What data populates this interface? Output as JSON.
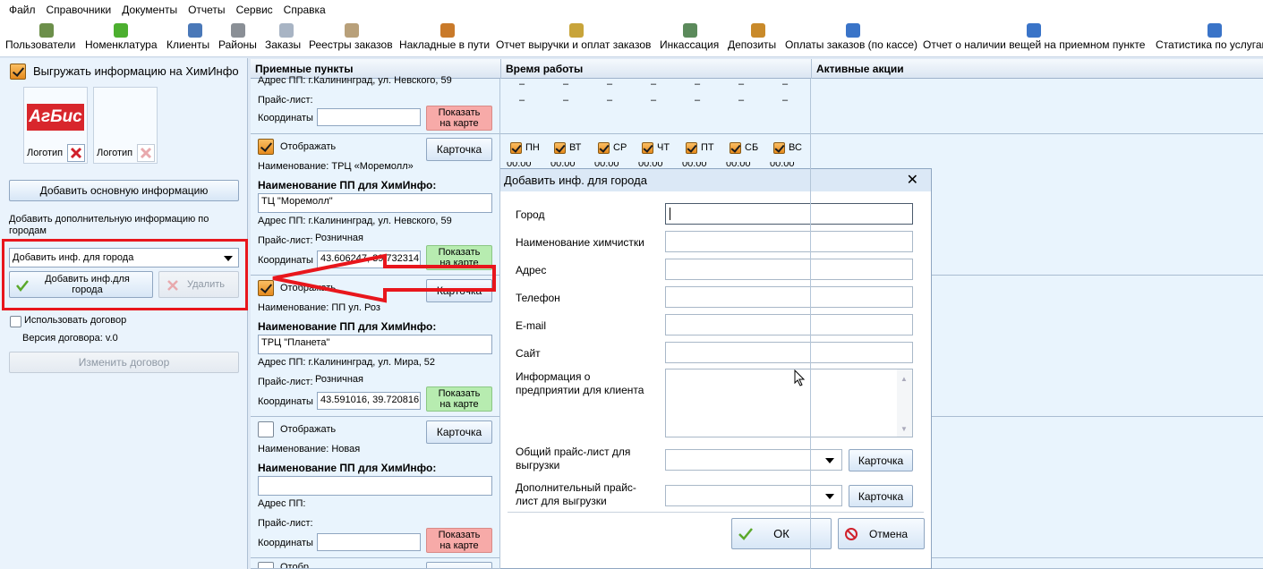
{
  "menu": [
    "Файл",
    "Справочники",
    "Документы",
    "Отчеты",
    "Сервис",
    "Справка"
  ],
  "toolbar": [
    {
      "label": "Пользователи",
      "icon": "users-icon",
      "color": "#6c8f4a"
    },
    {
      "label": "Номенклатура",
      "icon": "nomenclature-icon",
      "color": "#4caf2f"
    },
    {
      "label": "Клиенты",
      "icon": "clients-icon",
      "color": "#4a78b8"
    },
    {
      "label": "Районы",
      "icon": "districts-icon",
      "color": "#8a8f96"
    },
    {
      "label": "Заказы",
      "icon": "orders-icon",
      "color": "#a8b4c4"
    },
    {
      "label": "Реестры заказов",
      "icon": "order-registers-icon",
      "color": "#b8a07a"
    },
    {
      "label": "Накладные в пути",
      "icon": "truck-icon",
      "color": "#c97a2a"
    },
    {
      "label": "Отчет выручки и оплат заказов",
      "icon": "report-books-icon",
      "color": "#c8a43a"
    },
    {
      "label": "Инкассация",
      "icon": "cash-collection-icon",
      "color": "#5b8a5b"
    },
    {
      "label": "Депозиты",
      "icon": "deposits-icon",
      "color": "#c98a2a"
    },
    {
      "label": "Оплаты заказов (по кассе)",
      "icon": "payments-icon",
      "color": "#3a74c8"
    },
    {
      "label": "Отчет о наличии вещей на приемном пункте",
      "icon": "items-report-icon",
      "color": "#3a74c8"
    },
    {
      "label": "Статистика по услугам",
      "icon": "statistics-icon",
      "color": "#3a74c8"
    }
  ],
  "left": {
    "export_checkbox_label": "Выгружать информацию на ХимИнфо",
    "logo_text": "АгБис",
    "logo_label_1": "Логотип",
    "logo_label_2": "Логотип",
    "add_main_info_button": "Добавить основную информацию",
    "add_city_info_caption": "Добавить дополнительную информацию по городам",
    "city_info_select": "Добавить инф. для города",
    "add_city_info_button": "Добавить инф.для города",
    "delete_button": "Удалить",
    "use_contract_label": "Использовать договор",
    "contract_version_label": "Версия договора: v.0",
    "change_contract_button": "Изменить договор",
    "annotation_color": "#e8161c"
  },
  "grid": {
    "headers": [
      "Приемные пункты",
      "Время работы",
      "Активные акции"
    ],
    "days": [
      "ПН",
      "ВТ",
      "СР",
      "ЧТ",
      "ПТ",
      "СБ",
      "ВС"
    ],
    "time_placeholder": "00:00",
    "dash": "–",
    "rows": [
      {
        "partial": true,
        "address": "Адрес ПП: г.Калининград, ул. Невского, 59",
        "price_label": "Прайс-лист:",
        "price_value": "",
        "coords_label": "Координаты",
        "coords_value": "",
        "map_button": "Показать на карте"
      },
      {
        "display_label": "Отображать",
        "card_button": "Карточка",
        "name": "Наименование: ТРЦ «Моремолл»",
        "himinfo_label": "Наименование ПП для ХимИнфо:",
        "himinfo_value": "ТЦ \"Моремолл\"",
        "address": "Адрес ПП: г.Калининград, ул. Невского, 59",
        "price_label": "Прайс-лист:",
        "price_value": "Розничная",
        "coords_label": "Координаты",
        "coords_value": "43.606247, 39.732314",
        "map_button": "Показать на карте"
      },
      {
        "display_label": "Отображать",
        "card_button": "Карточка",
        "name": "Наименование: ПП ул. Роз",
        "himinfo_label": "Наименование ПП для ХимИнфо:",
        "himinfo_value": "ТРЦ \"Планета\"",
        "address": "Адрес ПП: г.Калининград, ул. Мира, 52",
        "price_label": "Прайс-лист:",
        "price_value": "Розничная",
        "coords_label": "Координаты",
        "coords_value": "43.591016, 39.720816",
        "map_button": "Показать на карте"
      },
      {
        "display_label": "Отображать",
        "card_button": "Карточка",
        "name": "Наименование: Новая",
        "himinfo_label": "Наименование ПП для ХимИнфо:",
        "himinfo_value": "",
        "address": "Адрес ПП:",
        "price_label": "Прайс-лист:",
        "price_value": "",
        "coords_label": "Координаты",
        "coords_value": "",
        "map_button": "Показать на карте"
      }
    ],
    "last_partial_label": "Отобр"
  },
  "dialog": {
    "title": "Добавить инф. для города",
    "fields": [
      {
        "label": "Город",
        "value": ""
      },
      {
        "label": "Наименование химчистки",
        "value": ""
      },
      {
        "label": "Адрес",
        "value": ""
      },
      {
        "label": "Телефон",
        "value": ""
      },
      {
        "label": "E-mail",
        "value": ""
      },
      {
        "label": "Сайт",
        "value": ""
      }
    ],
    "info_label": "Информация о предприятии для клиента",
    "general_price_label": "Общий прайс-лист для выгрузки",
    "extra_price_label": "Дополнительный прайс-лист для выгрузки",
    "card_button": "Карточка",
    "ok_button": "ОК",
    "cancel_button": "Отмена"
  }
}
